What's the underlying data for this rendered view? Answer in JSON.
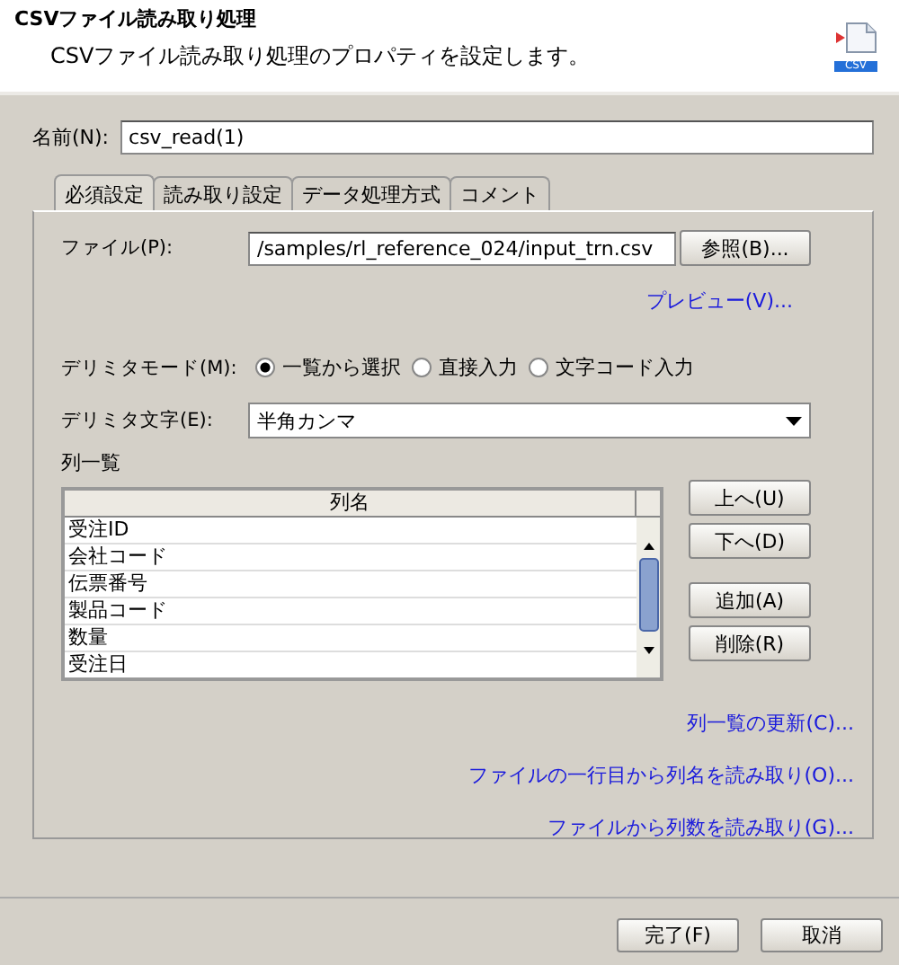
{
  "header": {
    "title": "CSVファイル読み取り処理",
    "subtitle": "CSVファイル読み取り処理のプロパティを設定します。",
    "icon_label": "CSV"
  },
  "name_field": {
    "label": "名前(N):",
    "value": "csv_read(1)"
  },
  "tabs": [
    {
      "label": "必須設定",
      "selected": true
    },
    {
      "label": "読み取り設定",
      "selected": false
    },
    {
      "label": "データ処理方式",
      "selected": false
    },
    {
      "label": "コメント",
      "selected": false
    }
  ],
  "file_field": {
    "label": "ファイル(P):",
    "value": "/samples/rl_reference_024/input_trn.csv",
    "button": "参照(B)..."
  },
  "preview_link": "プレビュー(V)...",
  "delimiter_mode": {
    "label": "デリミタモード(M):",
    "options": [
      {
        "label": "一覧から選択",
        "selected": true
      },
      {
        "label": "直接入力",
        "selected": false
      },
      {
        "label": "文字コード入力",
        "selected": false
      }
    ]
  },
  "delimiter_char": {
    "label": "デリミタ文字(E):",
    "value": "半角カンマ"
  },
  "column_list": {
    "label": "列一覧",
    "header": "列名",
    "rows": [
      "受注ID",
      "会社コード",
      "伝票番号",
      "製品コード",
      "数量",
      "受注日"
    ],
    "buttons": [
      "上へ(U)",
      "下へ(D)",
      "追加(A)",
      "削除(R)"
    ]
  },
  "links": [
    "列一覧の更新(C)...",
    "ファイルの一行目から列名を読み取り(O)...",
    "ファイルから列数を読み取り(G)..."
  ],
  "footer_buttons": [
    "完了(F)",
    "取消"
  ]
}
